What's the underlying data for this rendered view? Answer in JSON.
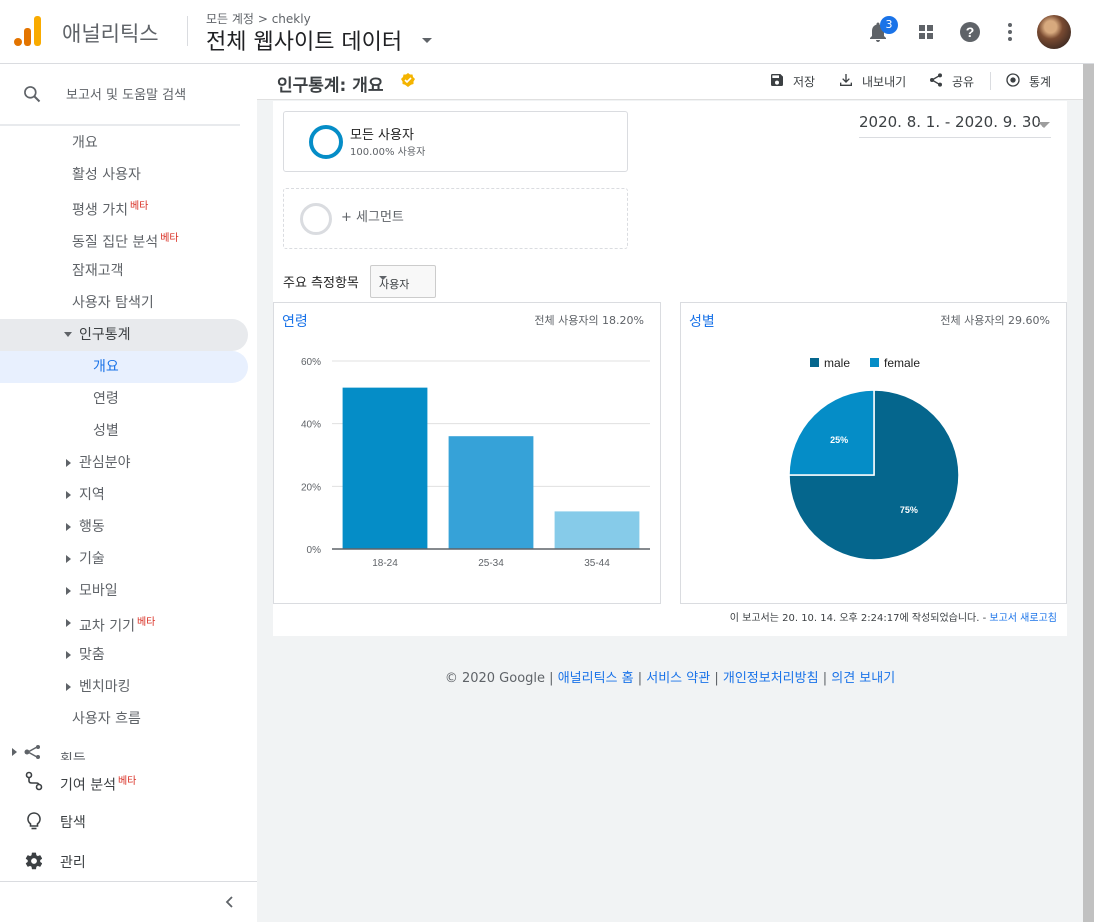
{
  "header": {
    "app_name": "애널리틱스",
    "breadcrumb_all": "모든 계정",
    "breadcrumb_sep": ">",
    "breadcrumb_account": "chekly",
    "view_title": "전체 웹사이트 데이터",
    "notification_count": "3",
    "icons": [
      "bell-icon",
      "apps-grid-icon",
      "help-icon",
      "more-vert-icon",
      "avatar"
    ]
  },
  "sidebar": {
    "search_placeholder": "보고서 및 도움말 검색",
    "items": [
      {
        "label": "개요"
      },
      {
        "label": "활성 사용자"
      },
      {
        "label": "평생 가치",
        "beta": "베타"
      },
      {
        "label": "동질 집단 분석",
        "beta": "베타"
      },
      {
        "label": "잠재고객"
      },
      {
        "label": "사용자 탐색기"
      },
      {
        "label": "인구통계"
      },
      {
        "label": "개요"
      },
      {
        "label": "연령"
      },
      {
        "label": "성별"
      },
      {
        "label": "관심분야"
      },
      {
        "label": "지역"
      },
      {
        "label": "행동"
      },
      {
        "label": "기술"
      },
      {
        "label": "모바일"
      },
      {
        "label": "교차 기기",
        "beta": "베타"
      },
      {
        "label": "맞춤"
      },
      {
        "label": "벤치마킹"
      },
      {
        "label": "사용자 흐름"
      },
      {
        "label": "획득"
      }
    ],
    "bottom": [
      {
        "label": "기여 분석",
        "beta": "베타"
      },
      {
        "label": "탐색"
      },
      {
        "label": "관리"
      }
    ]
  },
  "page": {
    "title": "인구통계: 개요",
    "actions": {
      "save": "저장",
      "export": "내보내기",
      "share": "공유",
      "insights": "통계"
    }
  },
  "segment": {
    "name": "모든 사용자",
    "share": "100.00% 사용자",
    "add_label": "+ 세그먼트"
  },
  "date_range": "2020. 8. 1. - 2020. 9. 30.",
  "metric": {
    "label": "주요 측정항목",
    "selected": "사용자"
  },
  "age_card": {
    "title": "연령",
    "pct_label": "전체 사용자의 18.20%"
  },
  "gender_card": {
    "title": "성별",
    "pct_label": "전체 사용자의 29.60%"
  },
  "chart_data": [
    {
      "type": "bar",
      "categories": [
        "18-24",
        "25-34",
        "35-44"
      ],
      "values": [
        51.5,
        36,
        12
      ],
      "ylim": [
        0,
        60
      ],
      "yticks": [
        "0%",
        "20%",
        "40%",
        "60%"
      ],
      "colors": [
        "#058dc7",
        "#36a2d8",
        "#86cbe9"
      ],
      "grid": true
    },
    {
      "type": "pie",
      "labels": [
        "male",
        "female"
      ],
      "values": [
        75,
        25
      ],
      "value_labels": [
        "75%",
        "25%"
      ],
      "colors": [
        "#05668d",
        "#058dc7"
      ],
      "legend": "top"
    }
  ],
  "report_footer": {
    "text": "이 보고서는 20. 10. 14. 오후 2:24:17에 작성되었습니다. - ",
    "link": "보고서 새로고침"
  },
  "footer": {
    "copyright": "© 2020 Google",
    "links": [
      "애널리틱스 홈",
      "서비스 약관",
      "개인정보처리방침",
      "의견 보내기"
    ]
  }
}
